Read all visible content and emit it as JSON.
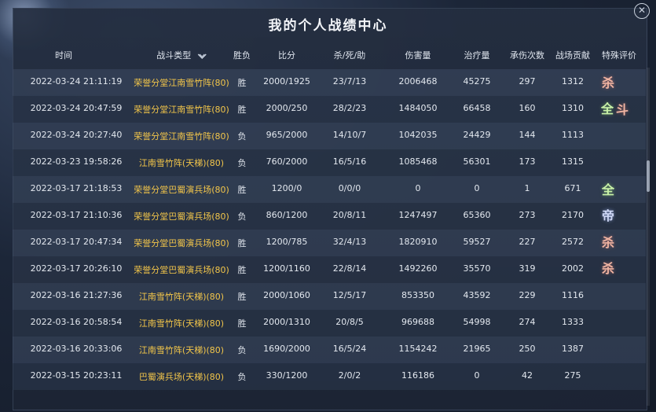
{
  "window": {
    "title": "我的个人战绩中心",
    "close_label": "✕"
  },
  "background": {
    "left_text": "",
    "right_text": ""
  },
  "columns": [
    "时间",
    "战斗类型",
    "胜负",
    "比分",
    "杀/死/助",
    "伤害量",
    "治疗量",
    "承伤次数",
    "战场贡献",
    "特殊评价"
  ],
  "rows": [
    {
      "time": "2022-03-24 21:11:19",
      "type": "荣誉分堂江南雪竹阵(80)",
      "result": "胜",
      "score": "2000/1925",
      "kda": "23/7/13",
      "damage": "2006468",
      "heal": "45275",
      "taken": "297",
      "contrib": "1312"
    },
    {
      "time": "2022-03-24 20:47:59",
      "type": "荣誉分堂江南雪竹阵(80)",
      "result": "胜",
      "score": "2000/250",
      "kda": "28/2/23",
      "damage": "1484050",
      "heal": "66458",
      "taken": "160",
      "contrib": "1310"
    },
    {
      "time": "2022-03-24 20:27:40",
      "type": "荣誉分堂江南雪竹阵(80)",
      "result": "负",
      "score": "965/2000",
      "kda": "14/10/7",
      "damage": "1042035",
      "heal": "24429",
      "taken": "144",
      "contrib": "1113"
    },
    {
      "time": "2022-03-23 19:58:26",
      "type": "江南雪竹阵(天梯)(80)",
      "result": "负",
      "score": "760/2000",
      "kda": "16/5/16",
      "damage": "1085468",
      "heal": "56301",
      "taken": "173",
      "contrib": "1315"
    },
    {
      "time": "2022-03-17 21:18:53",
      "type": "荣誉分堂巴蜀演兵场(80)",
      "result": "胜",
      "score": "1200/0",
      "kda": "0/0/0",
      "damage": "0",
      "heal": "0",
      "taken": "1",
      "contrib": "671"
    },
    {
      "time": "2022-03-17 21:10:36",
      "type": "荣誉分堂巴蜀演兵场(80)",
      "result": "负",
      "score": "860/1200",
      "kda": "20/8/11",
      "damage": "1247497",
      "heal": "65360",
      "taken": "273",
      "contrib": "2170"
    },
    {
      "time": "2022-03-17 20:47:34",
      "type": "荣誉分堂巴蜀演兵场(80)",
      "result": "胜",
      "score": "1200/785",
      "kda": "32/4/13",
      "damage": "1820910",
      "heal": "59527",
      "taken": "227",
      "contrib": "2572"
    },
    {
      "time": "2022-03-17 20:26:10",
      "type": "荣誉分堂巴蜀演兵场(80)",
      "result": "胜",
      "score": "1200/1160",
      "kda": "22/8/14",
      "damage": "1492260",
      "heal": "35570",
      "taken": "319",
      "contrib": "2002"
    },
    {
      "time": "2022-03-16 21:27:36",
      "type": "江南雪竹阵(天梯)(80)",
      "result": "胜",
      "score": "2000/1060",
      "kda": "12/5/17",
      "damage": "853350",
      "heal": "43592",
      "taken": "229",
      "contrib": "1116"
    },
    {
      "time": "2022-03-16 20:58:54",
      "type": "江南雪竹阵(天梯)(80)",
      "result": "胜",
      "score": "2000/1310",
      "kda": "20/8/5",
      "damage": "969688",
      "heal": "54998",
      "taken": "274",
      "contrib": "1333"
    },
    {
      "time": "2022-03-16 20:33:06",
      "type": "江南雪竹阵(天梯)(80)",
      "result": "负",
      "score": "1690/2000",
      "kda": "16/5/24",
      "damage": "1154242",
      "heal": "21965",
      "taken": "250",
      "contrib": "1387"
    },
    {
      "time": "2022-03-15 20:23:11",
      "type": "巴蜀演兵场(天梯)(80)",
      "result": "负",
      "score": "330/1200",
      "kda": "2/0/2",
      "damage": "116186",
      "heal": "0",
      "taken": "42",
      "contrib": "275"
    }
  ],
  "badges": {
    "sha": "杀",
    "quan": "全",
    "dou": "斗",
    "di": "帝"
  },
  "colors": {
    "type_text": "#f3c64a",
    "badge_kill": "#f0b4a2",
    "badge_all": "#c9f2a8"
  }
}
